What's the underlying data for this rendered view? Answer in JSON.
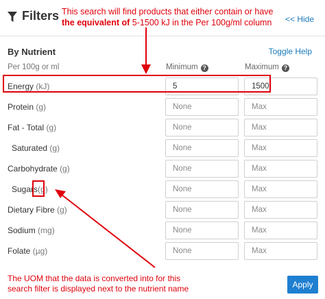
{
  "header": {
    "title": "Filters",
    "hide_label": "<< Hide",
    "icon": "funnel-icon"
  },
  "annotation_top": {
    "line1": "This search will find products that either contain or have",
    "line2_bold": "the equivalent of",
    "line2_rest": " 5-1500 kJ in the Per 100g/ml column"
  },
  "section": {
    "title": "By Nutrient",
    "toggle_label": "Toggle Help"
  },
  "columns": {
    "per": "Per 100g or ml",
    "minimum": "Minimum",
    "maximum": "Maximum"
  },
  "nutrients": [
    {
      "name": "Energy",
      "uom": "(kJ)",
      "min": "5",
      "max": "1500",
      "indent": false
    },
    {
      "name": "Protein",
      "uom": "(g)",
      "min": "",
      "max": "",
      "indent": false
    },
    {
      "name": "Fat - Total",
      "uom": "(g)",
      "min": "",
      "max": "",
      "indent": false
    },
    {
      "name": "Saturated",
      "uom": "(g)",
      "min": "",
      "max": "",
      "indent": true
    },
    {
      "name": "Carbohydrate",
      "uom": "(g)",
      "min": "",
      "max": "",
      "indent": false
    },
    {
      "name": "Sugars",
      "uom": "(g)",
      "min": "",
      "max": "",
      "indent": true
    },
    {
      "name": "Dietary Fibre",
      "uom": "(g)",
      "min": "",
      "max": "",
      "indent": false
    },
    {
      "name": "Sodium",
      "uom": "(mg)",
      "min": "",
      "max": "",
      "indent": false
    },
    {
      "name": "Folate",
      "uom": "(µg)",
      "min": "",
      "max": "",
      "indent": false
    }
  ],
  "placeholders": {
    "min": "None",
    "max": "Max"
  },
  "annotation_bottom": {
    "line1": "The UOM that the data is converted into for this",
    "line2": "search filter is displayed next to the nutrient name"
  },
  "apply_label": "Apply",
  "colors": {
    "annotation": "#e0000b",
    "link": "#1a7ab9",
    "apply_button": "#1f7fd1"
  }
}
